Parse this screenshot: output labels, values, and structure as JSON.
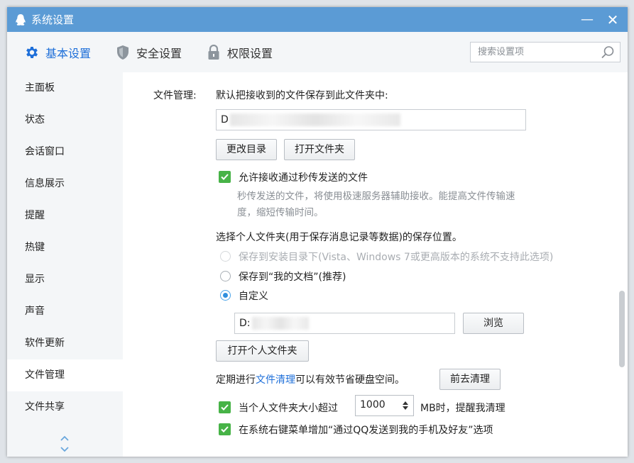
{
  "window": {
    "title": "系统设置",
    "minimize_glyph": "—",
    "close_glyph": "✕"
  },
  "tabs": [
    {
      "label": "基本设置",
      "icon": "gear-icon",
      "active": true
    },
    {
      "label": "安全设置",
      "icon": "shield-icon",
      "active": false
    },
    {
      "label": "权限设置",
      "icon": "lock-icon",
      "active": false
    }
  ],
  "search": {
    "placeholder": "搜索设置项",
    "value": ""
  },
  "sidebar": {
    "items": [
      {
        "label": "主面板"
      },
      {
        "label": "状态"
      },
      {
        "label": "会话窗口"
      },
      {
        "label": "信息展示"
      },
      {
        "label": "提醒"
      },
      {
        "label": "热键"
      },
      {
        "label": "显示"
      },
      {
        "label": "声音"
      },
      {
        "label": "软件更新"
      },
      {
        "label": "文件管理",
        "active": true
      },
      {
        "label": "文件共享"
      }
    ]
  },
  "file_mgmt": {
    "section_label": "文件管理:",
    "save_desc": "默认把接收到的文件保存到此文件夹中:",
    "save_path_prefix": "D",
    "change_dir_btn": "更改目录",
    "open_folder_btn": "打开文件夹",
    "allow_flash": {
      "label": "允许接收通过秒传发送的文件",
      "checked": true
    },
    "flash_desc_1": "秒传发送的文件，将使用极速服务器辅助接收。能提高文件传输速",
    "flash_desc_2": "度，缩短传输时间。",
    "personal_title": "选择个人文件夹(用于保存消息记录等数据)的保存位置。",
    "radio_options": [
      {
        "label": "保存到安装目录下(Vista、Windows 7或更高版本的系统不支持此选项)",
        "disabled": true,
        "selected": false
      },
      {
        "label": "保存到“我的文档”(推荐)",
        "disabled": false,
        "selected": false
      },
      {
        "label": "自定义",
        "disabled": false,
        "selected": true
      }
    ],
    "custom_path_prefix": "D:",
    "browse_btn": "浏览",
    "open_personal_btn": "打开个人文件夹",
    "cleanup_pre": "定期进行",
    "cleanup_link": "文件清理",
    "cleanup_post": "可以有效节省硬盘空间。",
    "go_clean_btn": "前去清理",
    "size_check": {
      "label_pre": "当个人文件夹大小超过",
      "value": "1000",
      "label_post": "MB时，提醒我清理",
      "checked": true
    },
    "context_check": {
      "label": "在系统右键菜单增加“通过QQ发送到我的手机及好友”选项",
      "checked": true
    }
  },
  "colors": {
    "titlebar": "#5b9bd5",
    "accent": "#1e6fd9",
    "check": "#47b347"
  }
}
